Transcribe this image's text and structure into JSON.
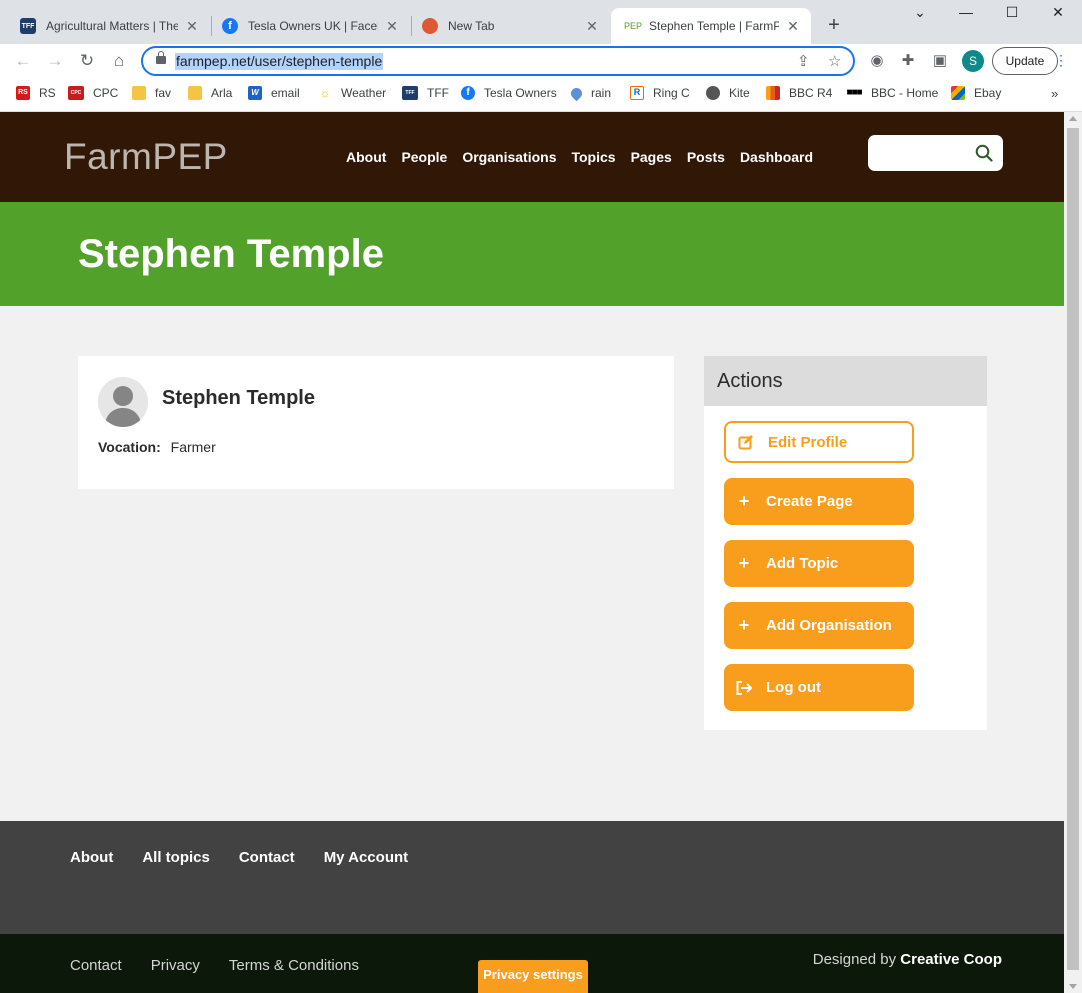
{
  "browser": {
    "tabs": [
      {
        "title": "Agricultural Matters | The",
        "icon": "TFF"
      },
      {
        "title": "Tesla Owners UK | Facebo",
        "icon": "f"
      },
      {
        "title": "New Tab",
        "icon": ""
      },
      {
        "title": "Stephen Temple | FarmPEP",
        "icon": "PEP"
      }
    ],
    "url": "farmpep.net/user/stephen-temple",
    "profile_initial": "S",
    "update_label": "Update",
    "bookmarks": [
      {
        "label": "RS",
        "icon": "RS",
        "color": "#d21c1c"
      },
      {
        "label": "CPC",
        "icon": "CPC",
        "color": "#c41e1e"
      },
      {
        "label": "fav",
        "icon": "",
        "color": "#f4c542"
      },
      {
        "label": "Arla",
        "icon": "",
        "color": "#f4c542"
      },
      {
        "label": "email",
        "icon": "W",
        "color": "#1e64c8"
      },
      {
        "label": "Weather",
        "icon": "",
        "color": "#f4b400"
      },
      {
        "label": "TFF",
        "icon": "TFF",
        "color": "#1d3d6b"
      },
      {
        "label": "Tesla Owners",
        "icon": "f",
        "color": "#1877f2"
      },
      {
        "label": "rain",
        "icon": "",
        "color": "#5b8fd6"
      },
      {
        "label": "Ring C",
        "icon": "R",
        "color": "#ef6c00"
      },
      {
        "label": "Kite",
        "icon": "",
        "color": "#555555"
      },
      {
        "label": "BBC R4",
        "icon": "",
        "color": "#e85d1b"
      },
      {
        "label": "BBC - Home",
        "icon": "",
        "color": "#000000"
      },
      {
        "label": "Ebay",
        "icon": "",
        "color": "#2c7be5"
      }
    ]
  },
  "site": {
    "logo": "FarmPEP",
    "nav": [
      "About",
      "People",
      "Organisations",
      "Topics",
      "Pages",
      "Posts",
      "Dashboard"
    ],
    "search_placeholder": ""
  },
  "page": {
    "title": "Stephen Temple"
  },
  "profile": {
    "name": "Stephen Temple",
    "vocation_label": "Vocation:",
    "vocation_value": "Farmer"
  },
  "actions": {
    "heading": "Actions",
    "buttons": [
      {
        "label": "Edit Profile",
        "icon": "edit-icon"
      },
      {
        "label": "Create Page",
        "icon": "plus-icon"
      },
      {
        "label": "Add Topic",
        "icon": "plus-icon"
      },
      {
        "label": "Add Organisation",
        "icon": "plus-icon"
      },
      {
        "label": "Log out",
        "icon": "logout-icon"
      }
    ]
  },
  "footer": {
    "top_links": [
      "About",
      "All topics",
      "Contact",
      "My Account"
    ],
    "bottom_links": [
      "Contact",
      "Privacy",
      "Terms & Conditions"
    ],
    "credit_prefix": "Designed by",
    "credit_name": "Creative Coop",
    "privacy_settings": "Privacy settings"
  },
  "colors": {
    "header_bg": "#311806",
    "banner_green": "#52a12a",
    "accent_orange": "#f99d1c",
    "footer_top": "#424242",
    "footer_bottom": "#0c1809"
  }
}
